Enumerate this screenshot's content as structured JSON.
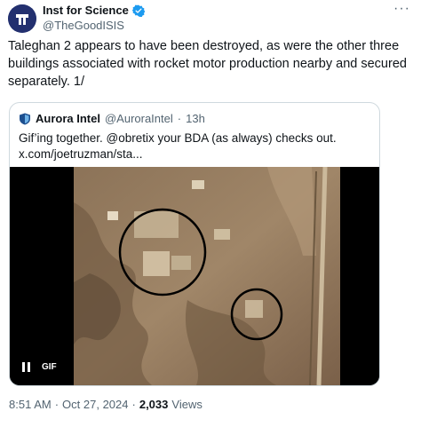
{
  "author": {
    "display_name": "Inst for Science",
    "handle": "@TheGoodISIS"
  },
  "tweet": {
    "text": "Taleghan 2 appears to have been destroyed, as were the other three buildings associated with rocket motor production nearby and secured separately. 1/"
  },
  "quoted": {
    "display_name": "Aurora Intel",
    "handle": "@AuroraIntel",
    "separator": "·",
    "time": "13h",
    "text": "Gif’ing together. @obretix your BDA (as always) checks out. x.com/joetruzman/sta...",
    "media_badge": "GIF"
  },
  "meta": {
    "time": "8:51 AM",
    "dot1": "·",
    "date": "Oct 27, 2024",
    "dot2": "·",
    "views_count": "2,033",
    "views_label": "Views"
  },
  "more_glyph": "···",
  "colors": {
    "verified": "#1d9bf0",
    "text_primary": "#0f1419",
    "text_secondary": "#536471",
    "border": "#cfd9de"
  },
  "icons": {
    "avatar": "institute-logo",
    "verified": "verified-badge-icon",
    "quoted_avatar": "aurora-shield-icon",
    "pause": "pause-icon",
    "more": "more-icon"
  }
}
